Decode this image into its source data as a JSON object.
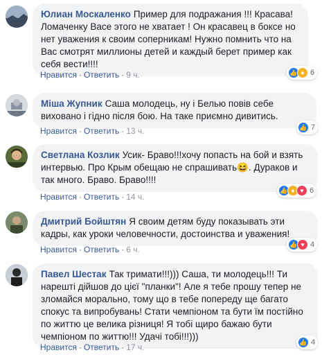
{
  "comments": [
    {
      "author": "Юлиан Москаленко",
      "text": "Пример для подражания !!! Красава! Ломаченку Васе этого не хватает ! Он красавец в боксе но нет уважения к своим соперникам! Нужно помнить что на Вас смотрят миллионы детей и каждый берет пример как себя вести!!!!",
      "like_label": "Нравится",
      "reply_label": "Ответить",
      "time": "9 ч.",
      "reactions": [
        "like-icon",
        "wow-icon"
      ],
      "reaction_count": "6"
    },
    {
      "author": "Міша Жупник",
      "text": "Саша молодець, ну і Белью повів себе виховано і гідно після бою. На таке приємно дивитись.",
      "like_label": "Нравится",
      "reply_label": "Ответить",
      "time": "13 ч.",
      "reactions": [
        "like-icon"
      ],
      "reaction_count": "7"
    },
    {
      "author": "Светлана Козлик",
      "text_before_emoji": "Усик- Браво!!!хочу попасть на бой и взять интервью. Про Крым обещаю не спрашивать",
      "text_after_emoji": ". Дураков и так много. Браво. Браво!!!!",
      "like_label": "Нравится",
      "reply_label": "Ответить",
      "time": "14 ч.",
      "reactions": [
        "like-icon",
        "haha-icon",
        "love-icon"
      ],
      "reaction_count": "6"
    },
    {
      "author": "Дмитрий Бойштян",
      "text": "Я своим детям буду показывать эти кадры, как уроки человечности, достоинства и уважения!",
      "like_label": "Нравится",
      "reply_label": "Ответить",
      "time": "6 ч.",
      "reactions": [
        "like-icon",
        "love-icon"
      ],
      "reaction_count": "4"
    },
    {
      "author": "Павел Шестак",
      "text": "Так тримати!!!))) Саша, ти молодець!!! Ти нарешті дійшов до цієї \"планки\"! Але я тебе прошу тепер не зломайся морально, тому що в тебе попереду ще багато спокус та випробувань! Стати чемпіоном та бути їм постійно по життю це велика різниця! Я тобі щиро бажаю бути чемпіоном по життю!!! Удачі тобі!!!)))",
      "like_label": "Нравится",
      "reply_label": "Ответить",
      "time": "17 ч.",
      "reactions": [
        "like-icon"
      ],
      "reaction_count": "4"
    }
  ],
  "separator": "·",
  "colors": {
    "author": "#385898",
    "bubble": "#f2f3f5",
    "meta": "#606770",
    "like": "#2078f4",
    "love": "#f33e58",
    "wow": "#f7b125"
  }
}
